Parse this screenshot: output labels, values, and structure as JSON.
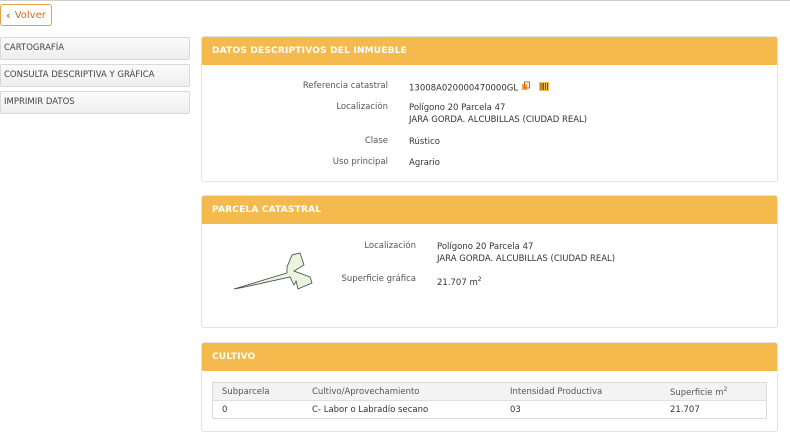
{
  "nav": {
    "back_label": "Volver"
  },
  "sidebar": {
    "items": [
      {
        "label": "CARTOGRAFÍA"
      },
      {
        "label": "CONSULTA DESCRIPTIVA Y GRÁFICA"
      },
      {
        "label": "IMPRIMIR DATOS"
      }
    ]
  },
  "descriptivos": {
    "title": "DATOS DESCRIPTIVOS DEL INMUEBLE",
    "referencia_label": "Referencia catastral",
    "referencia_value": "13008A020000470000GL",
    "localizacion_label": "Localización",
    "localizacion_line1": "Polígono 20 Parcela 47",
    "localizacion_line2": "JARA GORDA. ALCUBILLAS (CIUDAD REAL)",
    "clase_label": "Clase",
    "clase_value": "Rústico",
    "uso_label": "Uso principal",
    "uso_value": "Agrario"
  },
  "parcela": {
    "title": "PARCELA CATASTRAL",
    "localizacion_label": "Localización",
    "localizacion_line1": "Polígono 20 Parcela 47",
    "localizacion_line2": "JARA GORDA. ALCUBILLAS (CIUDAD REAL)",
    "superficie_label": "Superficie gráfica",
    "superficie_value": "21.707 m",
    "superficie_unit_sup": "2"
  },
  "cultivo": {
    "title": "CULTIVO",
    "headers": [
      "Subparcela",
      "Cultivo/Aprovechamiento",
      "Intensidad Productiva",
      "Superficie m"
    ],
    "header_sup": "2",
    "rows": [
      [
        "0",
        "C- Labor o Labradío secano",
        "03",
        "21.707"
      ]
    ]
  },
  "colors": {
    "accent": "#f4ba4d",
    "back_text": "#d2691e",
    "parcel_fill": "#e8f6e0"
  }
}
